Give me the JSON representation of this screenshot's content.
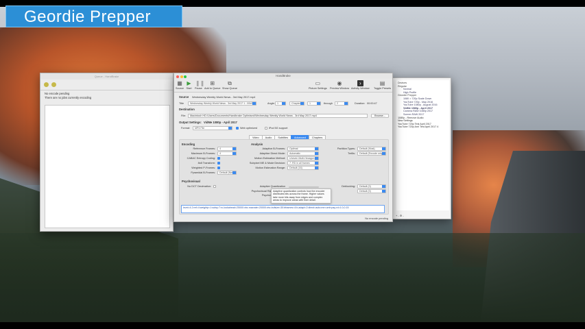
{
  "banner": {
    "title": "Geordie Prepper"
  },
  "colors": {
    "banner": "#2c8fd6",
    "accent": "#3b8af0"
  },
  "queue_window": {
    "title": "Queue - HandBrake",
    "messages": [
      "No encode pending",
      "There are no jobs currently encoding"
    ]
  },
  "handbrake": {
    "title": "HandBrake",
    "toolbar": {
      "source": "Source",
      "start": "Start",
      "pause": "Pause",
      "add_to_queue": "Add to Queue",
      "show_queue": "Show Queue",
      "picture_settings": "Picture Settings",
      "preview_window": "Preview Window",
      "activity_window": "Activity Window",
      "toggle_presets": "Toggle Presets"
    },
    "source": {
      "label": "Source",
      "value": "Wednesday Weekly World News - 3rd May 2017.mp4"
    },
    "title_row": {
      "label": "Title",
      "value": "Wednesday Weekly World News - 3rd May 2017 1 - 00h00m30s",
      "angle_label": "Angle:",
      "angle": "1",
      "chapters_label": "Chapters",
      "chapter_from": "1",
      "through_label": "through",
      "chapter_to": "2",
      "duration_label": "Duration:",
      "duration": "00:00:47"
    },
    "destination": {
      "heading": "Destination",
      "file_label": "File:",
      "file": "Macintosh HD:/Users/Documents/Handbrake Optimised/Wednesday Weekly World News - 3rd May 2017.mp4",
      "browse": "Browse..."
    },
    "output": {
      "heading": "Output Settings:",
      "preset": "VidMe 1080p - April 2017",
      "format_label": "Format:",
      "format": "MP4 File",
      "web_optimized": "Web optimized",
      "ipod": "iPod 5G support"
    },
    "tabs": [
      "Video",
      "Audio",
      "Subtitles",
      "Advanced",
      "Chapters"
    ],
    "encoding": {
      "heading": "Encoding",
      "reference_frames_label": "Reference Frames:",
      "reference_frames": "4",
      "max_bframes_label": "Maximum B-Frames:",
      "max_bframes": "4",
      "cabac_label": "CABAC Entropy Coding:",
      "8x8_label": "8x8 Transform:",
      "weighted_label": "Weighted P-Frames:",
      "pyramidal_label": "Pyramidal B-Frames:",
      "pyramidal": "Default (Normal)"
    },
    "analysis": {
      "heading": "Analysis",
      "adaptive_bframes_label": "Adaptive B-Frames:",
      "adaptive_bframes": "Optimal",
      "adaptive_direct_label": "Adaptive Direct Mode:",
      "adaptive_direct": "Automatic",
      "motion_method_label": "Motion Estimation Method:",
      "motion_method": "Uneven Multi-Hexagon",
      "subpixel_label": "Subpixel ME & Mode Decision:",
      "subpixel": "7: RD in all frames",
      "motion_range_label": "Motion Estimation Range:",
      "motion_range": "Default (16)"
    },
    "right_col": {
      "partition_label": "Partition Types:",
      "partition": "Default (Most)",
      "trellis_label": "Trellis:",
      "trellis": "Default (Encode only)"
    },
    "psychovisual": {
      "heading": "Psychovisual",
      "no_dct_label": "No DCT Decimation:",
      "aq_label": "Adaptive Quantization",
      "psy_rd_label": "Psychovisual Rate Distortion:",
      "psy_trellis_label": "Psychovisual Trellis:",
      "deblocking_label": "Deblocking:",
      "deblock1": "Default (0)",
      "deblock2": "Default (0)"
    },
    "tooltip": "Adaptive quantization controls how the encoder distributes bits across the frame. Higher values take more bits away from edges and complex areas to improve areas with finer detail.",
    "option_string": {
      "label": "Current x264 Advanced Option String:",
      "value": "level=4.2:ref=4:weightp=1:subq=7:rc-lookahead=25000:vbv-maxrate=20000:vbv-bufsize=30:bframes=4:b-adapt=2:direct=auto:me=umh:psy-rd=1.0,0.15"
    },
    "status": "No encode pending"
  },
  "presets": {
    "items": [
      {
        "label": "Devices",
        "kind": "group"
      },
      {
        "label": "Regular",
        "kind": "group"
      },
      {
        "label": "Normal",
        "kind": "sub"
      },
      {
        "label": "High Profile",
        "kind": "sub"
      },
      {
        "label": "Geordie Prepper",
        "kind": "group"
      },
      {
        "label": "1080 > 720p Scale Down",
        "kind": "sub"
      },
      {
        "label": "YouTube 720p - May 2016",
        "kind": "sub"
      },
      {
        "label": "YouTube 1080p - August 2016",
        "kind": "sub"
      },
      {
        "label": "VidMe 1080p - April 2017",
        "kind": "sel"
      },
      {
        "label": "Camera RAW 1080p 2017",
        "kind": "sub"
      },
      {
        "label": "Screen RAW 2017",
        "kind": "sub"
      },
      {
        "label": "1080p - Remove Audio",
        "kind": "plain"
      },
      {
        "label": "New Settings",
        "kind": "plain"
      },
      {
        "label": "YouTube 720p Test April 2017",
        "kind": "plain"
      },
      {
        "label": "YouTube 720p Anri Test April 2017 4",
        "kind": "plain"
      }
    ],
    "footer": "+ -  ✲ -"
  }
}
